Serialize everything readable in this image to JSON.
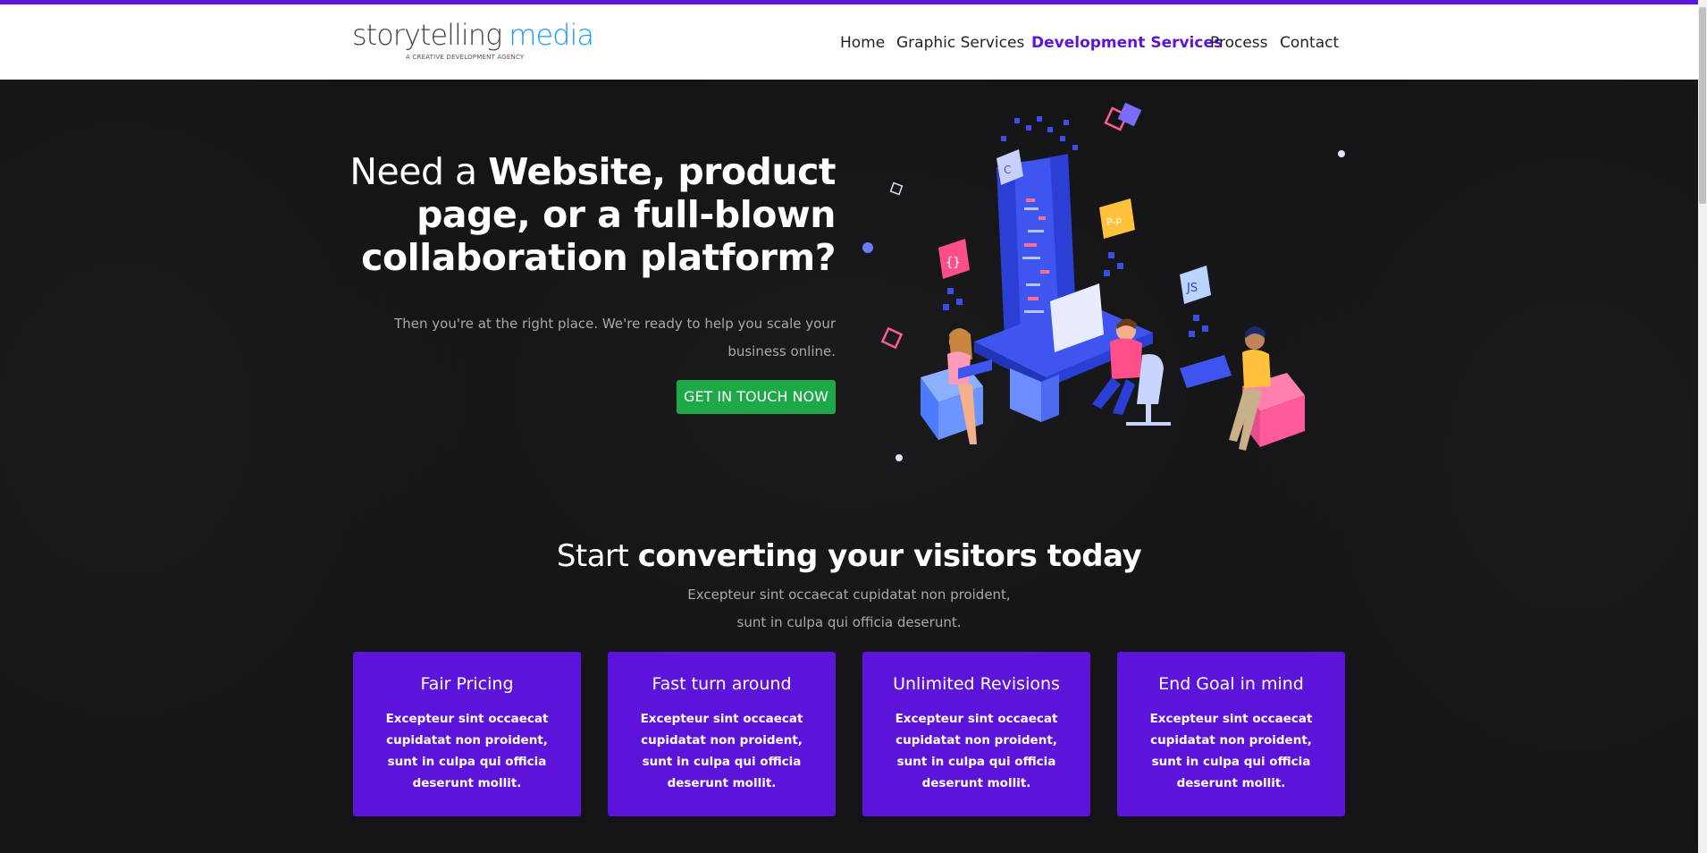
{
  "header": {
    "logo": {
      "story": "storytelling",
      "media": "media",
      "tagline": "A CREATIVE DEVELOPMENT AGENCY"
    },
    "nav": [
      {
        "label": "Home",
        "active": false
      },
      {
        "label": "Graphic Services",
        "active": false
      },
      {
        "label": "Development Services",
        "active": true
      },
      {
        "label": "Process",
        "active": false
      },
      {
        "label": "Contact",
        "active": false
      }
    ]
  },
  "hero": {
    "title_light": "Need a ",
    "title_bold": "Website, product page, or a full-blown collaboration platform?",
    "subtitle": "Then you're at the right place. We're ready to help you scale your business online.",
    "cta_label": "GET IN TOUCH NOW"
  },
  "section": {
    "title_light": "Start ",
    "title_bold": "converting your visitors today",
    "subtitle_line1": "Excepteur sint occaecat cupidatat non proident,",
    "subtitle_line2": "sunt in culpa qui officia deserunt."
  },
  "cards": [
    {
      "title": "Fair Pricing",
      "text": "Excepteur sint occaecat cupidatat non proident, sunt in culpa qui officia deserunt mollit."
    },
    {
      "title": "Fast turn around",
      "text": "Excepteur sint occaecat cupidatat non proident, sunt in culpa qui officia deserunt mollit."
    },
    {
      "title": "Unlimited Revisions",
      "text": "Excepteur sint occaecat cupidatat non proident, sunt in culpa qui officia deserunt mollit."
    },
    {
      "title": "End Goal in mind",
      "text": "Excepteur sint occaecat cupidatat non proident, sunt in culpa qui officia deserunt mollit."
    }
  ],
  "colors": {
    "accent": "#5b15db",
    "cta": "#1ea949",
    "logo_blue": "#1a9bf0",
    "background": "#141416"
  }
}
